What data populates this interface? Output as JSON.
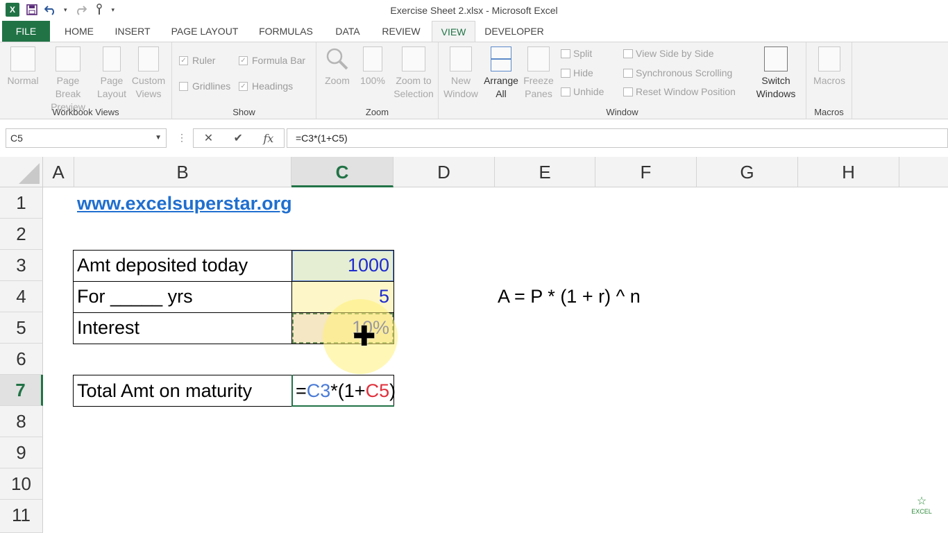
{
  "window": {
    "title": "Exercise Sheet 2.xlsx - Microsoft Excel"
  },
  "qat": {
    "app_icon": "X",
    "icons": [
      "save-icon",
      "undo-icon",
      "redo-icon",
      "touch-mode-icon",
      "customize-icon"
    ]
  },
  "tabs": [
    "FILE",
    "HOME",
    "INSERT",
    "PAGE LAYOUT",
    "FORMULAS",
    "DATA",
    "REVIEW",
    "VIEW",
    "DEVELOPER"
  ],
  "active_tab": "VIEW",
  "ribbon": {
    "workbook_views": {
      "label": "Workbook Views",
      "normal": "Normal",
      "page_break_1": "Page Break",
      "page_break_2": "Preview",
      "page_layout_1": "Page",
      "page_layout_2": "Layout",
      "custom_1": "Custom",
      "custom_2": "Views"
    },
    "show": {
      "label": "Show",
      "ruler": "Ruler",
      "formula_bar": "Formula Bar",
      "gridlines": "Gridlines",
      "headings": "Headings"
    },
    "zoom": {
      "label": "Zoom",
      "zoom": "Zoom",
      "hundred": "100%",
      "zoom_sel_1": "Zoom to",
      "zoom_sel_2": "Selection"
    },
    "window": {
      "label": "Window",
      "new_1": "New",
      "new_2": "Window",
      "arrange_1": "Arrange",
      "arrange_2": "All",
      "freeze_1": "Freeze",
      "freeze_2": "Panes",
      "split": "Split",
      "hide": "Hide",
      "unhide": "Unhide",
      "side_by_side": "View Side by Side",
      "sync_scroll": "Synchronous Scrolling",
      "reset_pos": "Reset Window Position",
      "switch_1": "Switch",
      "switch_2": "Windows"
    },
    "macros": {
      "label": "Macros",
      "macros": "Macros"
    }
  },
  "formula_bar": {
    "name_box": "C5",
    "cancel": "✕",
    "enter": "✔",
    "fx": "fx",
    "formula": "=C3*(1+C5)"
  },
  "columns": [
    "A",
    "B",
    "C",
    "D",
    "E",
    "F",
    "G",
    "H"
  ],
  "rows": [
    "1",
    "2",
    "3",
    "4",
    "5",
    "6",
    "7",
    "8",
    "9",
    "10",
    "11"
  ],
  "cells": {
    "B1": "www.excelsuperstar.org",
    "B3": "Amt deposited today",
    "C3": "1000",
    "B4": "For _____ yrs",
    "C4": "5",
    "B5": "Interest",
    "C5": "10%",
    "E4": "A = P * (1 + r) ^ n",
    "B7": "Total Amt on maturity",
    "C7_eq": "=",
    "C7_ref1": "C3",
    "C7_mid": "*(1+",
    "C7_ref2": "C5",
    "C7_end": ")"
  },
  "watermark": "EXCEL"
}
